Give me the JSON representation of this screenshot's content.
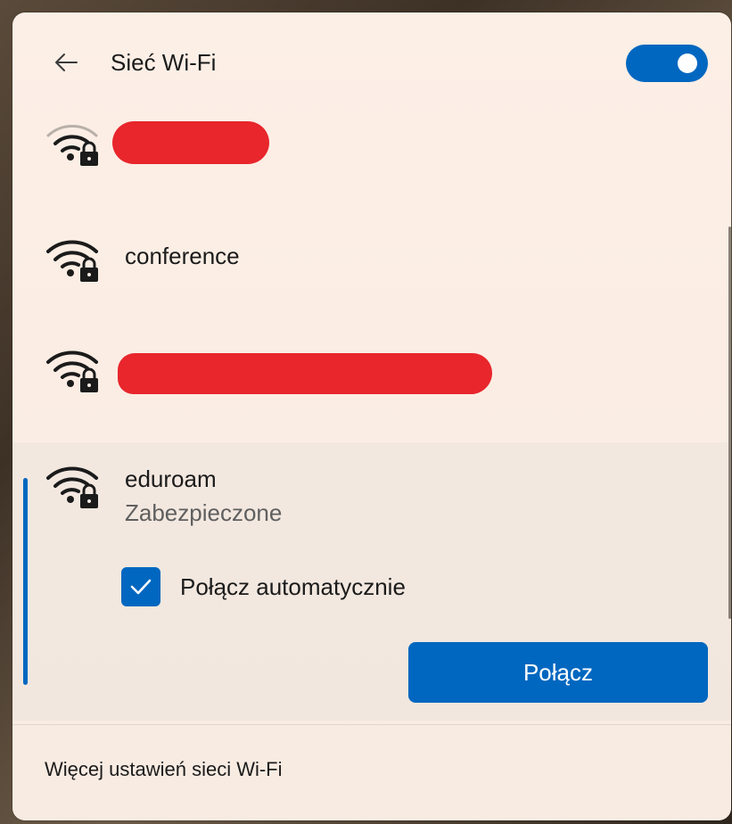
{
  "header": {
    "title": "Sieć Wi-Fi",
    "back_icon": "arrow-left-icon",
    "wifi_enabled": true
  },
  "networks": [
    {
      "ssid": "",
      "redacted": true,
      "secured": true,
      "signal": "medium"
    },
    {
      "ssid": "conference",
      "redacted": false,
      "secured": true,
      "signal": "full"
    },
    {
      "ssid": "",
      "redacted": true,
      "secured": true,
      "signal": "full"
    },
    {
      "ssid": "eduroam",
      "redacted": false,
      "secured": true,
      "signal": "full",
      "selected": true
    }
  ],
  "selected_network": {
    "ssid": "eduroam",
    "status": "Zabezpieczone",
    "auto_connect_label": "Połącz automatycznie",
    "auto_connect_checked": true,
    "connect_label": "Połącz"
  },
  "footer": {
    "more_settings_label": "Więcej ustawień sieci Wi-Fi"
  },
  "colors": {
    "accent": "#0067c0",
    "redaction": "#e8262c",
    "panel_bg": "#fbede4",
    "text": "#1b1b1b",
    "secondary_text": "#5f5f5f"
  }
}
